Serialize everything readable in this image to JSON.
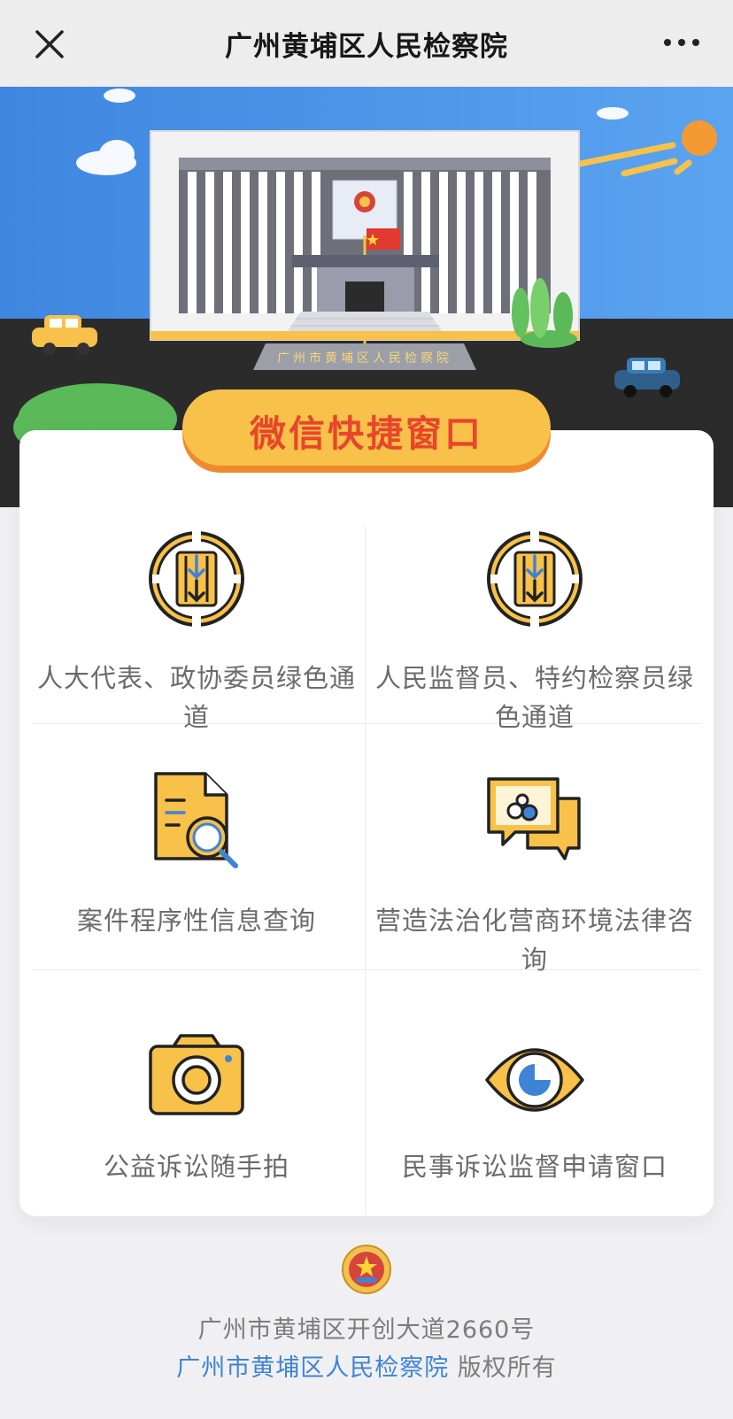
{
  "navbar": {
    "title": "广州黄埔区人民检察院",
    "close_icon": "close-icon",
    "more_icon": "more-dots-icon"
  },
  "banner": {
    "building_sign": "广州市黄埔区人民检察院"
  },
  "card": {
    "ribbon_title": "微信快捷窗口",
    "tiles": [
      {
        "label": "人大代表、政协委员绿色通道",
        "icon": "green-channel-icon"
      },
      {
        "label": "人民监督员、特约检察员绿色通道",
        "icon": "green-channel-icon"
      },
      {
        "label": "案件程序性信息查询",
        "icon": "document-search-icon"
      },
      {
        "label": "营造法治化营商环境法律咨询",
        "icon": "chat-consult-icon"
      },
      {
        "label": "公益诉讼随手拍",
        "icon": "camera-icon"
      },
      {
        "label": "民事诉讼监督申请窗口",
        "icon": "eye-icon"
      }
    ]
  },
  "footer": {
    "address": "广州市黄埔区开创大道2660号",
    "org_link": "广州市黄埔区人民检察院",
    "rights": " 版权所有"
  },
  "colors": {
    "accent_yellow": "#f7c14a",
    "ribbon_text": "#e8462b",
    "link_blue": "#3f83d6",
    "sky_blue": "#4a93e6",
    "road_dark": "#2a2a2a"
  }
}
